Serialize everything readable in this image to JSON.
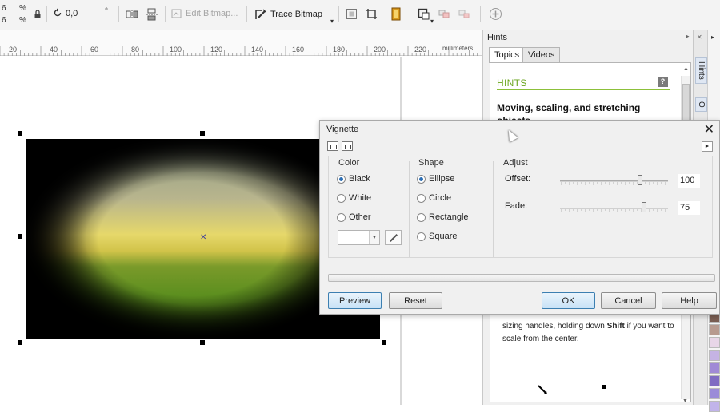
{
  "propbar": {
    "pct_top": "6",
    "pct_bottom": "6",
    "pct_sym_top": "%",
    "pct_sym_bottom": "%",
    "rotation_value": "0,0",
    "degree_sym": "°",
    "edit_bitmap_label": "Edit Bitmap...",
    "trace_bitmap_label": "Trace Bitmap"
  },
  "ruler": {
    "ticks": [
      "20",
      "40",
      "60",
      "80",
      "100",
      "120",
      "140",
      "160",
      "180",
      "200",
      "220"
    ],
    "unit": "millimeters"
  },
  "hints": {
    "panel_title": "Hints",
    "tabs": [
      {
        "label": "Topics",
        "active": true
      },
      {
        "label": "Videos",
        "active": false
      }
    ],
    "heading": "HINTS",
    "help_badge": "?",
    "subheading": "Moving, scaling, and stretching objects",
    "text_before": "sizing handles, holding down ",
    "text_bold": "Shift",
    "text_after": " if you want to scale from the center."
  },
  "right_dock": {
    "tabs": [
      "Hints",
      "O"
    ]
  },
  "palette": {
    "colors": [
      "#7a5d52",
      "#b79a8f",
      "#e8d6e8",
      "#c5b3e3",
      "#a08ad6",
      "#7f6cc2",
      "#9a8bd8",
      "#c1b4ea"
    ]
  },
  "dialog": {
    "title": "Vignette",
    "close_glyph": "✕",
    "expand_glyph": "►",
    "color_group": {
      "title": "Color",
      "options": [
        {
          "label": "Black",
          "selected": true
        },
        {
          "label": "White",
          "selected": false
        },
        {
          "label": "Other",
          "selected": false
        }
      ]
    },
    "shape_group": {
      "title": "Shape",
      "options": [
        {
          "label": "Ellipse",
          "selected": true
        },
        {
          "label": "Circle",
          "selected": false
        },
        {
          "label": "Rectangle",
          "selected": false
        },
        {
          "label": "Square",
          "selected": false
        }
      ]
    },
    "adjust_group": {
      "title": "Adjust",
      "offset_label": "Offset:",
      "offset_value": "100",
      "offset_level": 0.74,
      "fade_label": "Fade:",
      "fade_value": "75",
      "fade_level": 0.78
    },
    "buttons": {
      "preview": "Preview",
      "reset": "Reset",
      "ok": "OK",
      "cancel": "Cancel",
      "help": "Help"
    }
  },
  "colors": {
    "accent_green": "#6aa51d",
    "radio_blue": "#2d6fb6",
    "ok_border": "#3c7fb1"
  }
}
